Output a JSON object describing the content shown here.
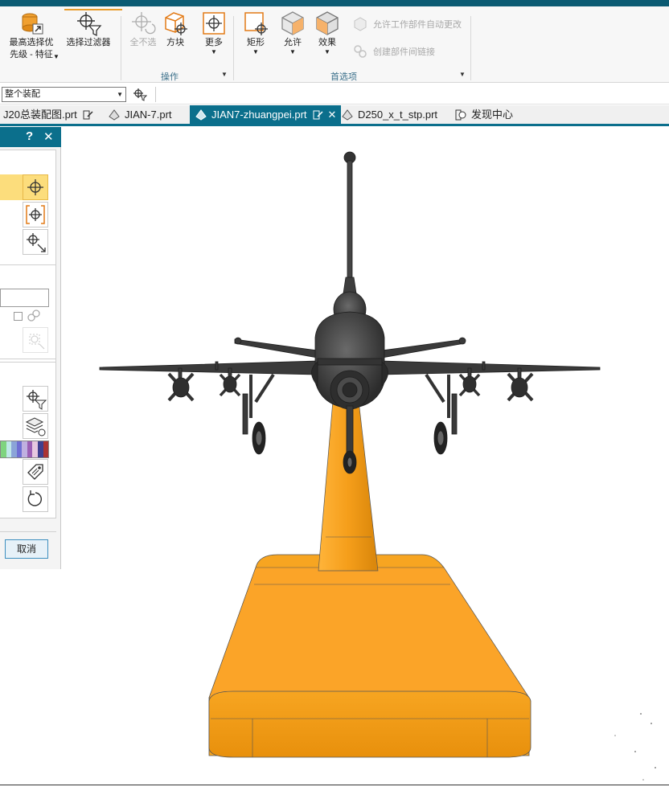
{
  "ribbon": {
    "buttons": [
      {
        "label1": "最高选择优",
        "label2": "先级 - 特征",
        "icon": "priority-icon"
      },
      {
        "label1": "选择过滤器",
        "icon": "select-filter-icon"
      },
      {
        "label1": "全不选",
        "icon": "deselect-all-icon",
        "disabled": true
      },
      {
        "label1": "方块",
        "icon": "block-select-icon"
      },
      {
        "label1": "更多",
        "icon": "more-icon"
      },
      {
        "label1": "矩形",
        "icon": "rectangle-select-icon"
      },
      {
        "label1": "允许",
        "icon": "allow-icon"
      },
      {
        "label1": "效果",
        "icon": "effect-icon"
      }
    ],
    "small_items": [
      {
        "label": "允许工作部件自动更改",
        "icon": "auto-change-icon",
        "disabled": true
      },
      {
        "label": "创建部件间链接",
        "icon": "link-parts-icon",
        "disabled": true
      }
    ],
    "group_labels": {
      "operate": "操作",
      "preferences": "首选项"
    }
  },
  "selection_bar": {
    "scope_value": "整个装配"
  },
  "tabs": [
    {
      "label": "J20总装配图.prt",
      "icon": "modified-icon"
    },
    {
      "label": "JIAN-7.prt",
      "icon": "part-icon"
    },
    {
      "label": "JIAN7-zhuangpei.prt",
      "icon": "part-icon",
      "active": true
    },
    {
      "label": "D250_x_t_stp.prt",
      "icon": "part-icon"
    },
    {
      "label": "发现中心",
      "icon": "discovery-icon"
    }
  ],
  "panel": {
    "help": "?",
    "close": "✕",
    "cancel_label": "取消"
  },
  "colors": {
    "accent": "#0b6f8c",
    "highlight": "#fcdd7c",
    "base": "#f59e1a",
    "aircraft": "#3a3a3a"
  }
}
